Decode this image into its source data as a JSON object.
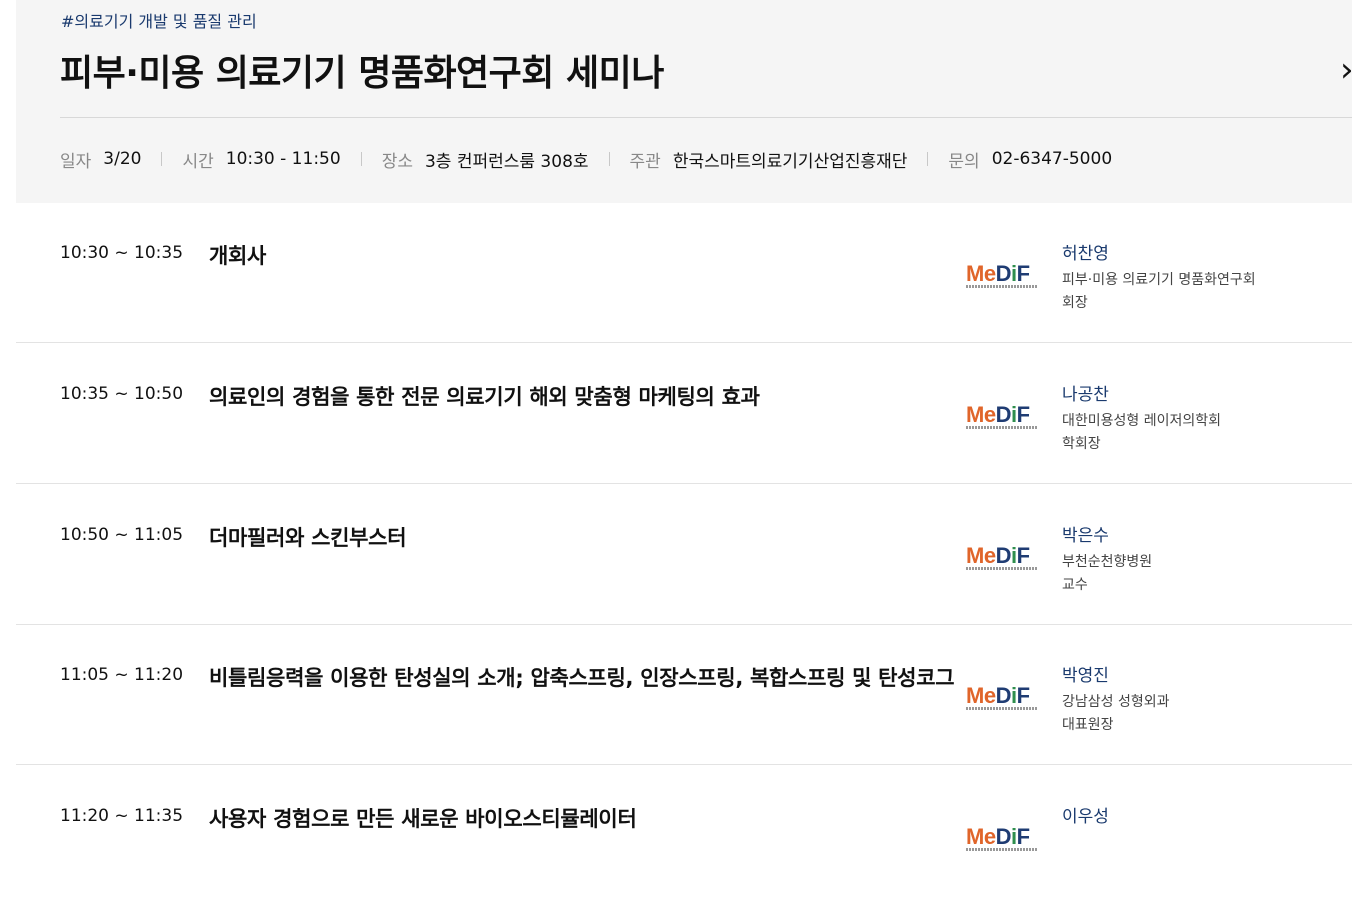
{
  "seminar": {
    "tag": "#의료기기 개발 및 품질 관리",
    "title": "피부·미용 의료기기 명품화연구회 세미나",
    "close_icon": "›"
  },
  "info": {
    "date_label": "일자",
    "date": "3/20",
    "time_label": "시간",
    "time": "10:30 - 11:50",
    "place_label": "장소",
    "place": "3층 컨퍼런스룸 308호",
    "host_label": "주관",
    "host": "한국스마트의료기기산업진흥재단",
    "contact_label": "문의",
    "contact": "02-6347-5000"
  },
  "logo": {
    "m": "Me",
    "d": "D",
    "i": "i",
    "f": "F"
  },
  "sessions": [
    {
      "time": "10:30 ~ 10:35",
      "title": "개회사",
      "speaker": "허찬영",
      "org": "피부·미용 의료기기 명품화연구회",
      "role": "회장"
    },
    {
      "time": "10:35 ~ 10:50",
      "title": "의료인의 경험을 통한 전문 의료기기 해외 맞춤형 마케팅의 효과",
      "speaker": "나공찬",
      "org": "대한미용성형 레이저의학회",
      "role": "학회장"
    },
    {
      "time": "10:50 ~ 11:05",
      "title": "더마필러와 스킨부스터",
      "speaker": "박은수",
      "org": "부천순천향병원",
      "role": "교수"
    },
    {
      "time": "11:05 ~ 11:20",
      "title": "비틀림응력을 이용한 탄성실의 소개; 압축스프링, 인장스프링, 복합스프링 및 탄성코그",
      "speaker": "박영진",
      "org": "강남삼성 성형외과",
      "role": "대표원장"
    },
    {
      "time": "11:20 ~ 11:35",
      "title": "사용자 경험으로 만든 새로운 바이오스티뮬레이터",
      "speaker": "이우성",
      "org": "",
      "role": ""
    }
  ]
}
